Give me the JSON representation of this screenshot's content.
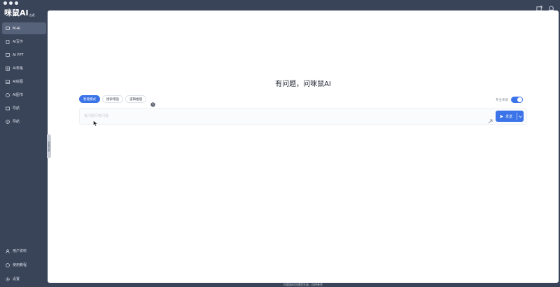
{
  "app": {
    "logo_main": "咪鼠AI",
    "logo_sub": "志遊"
  },
  "sidebar": {
    "items": [
      {
        "label": "M-AI",
        "icon": "chat-icon",
        "active": true
      },
      {
        "label": "AI写作",
        "icon": "document-icon"
      },
      {
        "label": "AI PPT",
        "icon": "presentation-icon"
      },
      {
        "label": "AI表格",
        "icon": "table-icon"
      },
      {
        "label": "AI绘图",
        "icon": "image-icon"
      },
      {
        "label": "AI图书",
        "icon": "book-icon"
      },
      {
        "label": "导航",
        "icon": "compass-icon"
      },
      {
        "label": "导航",
        "icon": "navigation-icon"
      }
    ],
    "bottom_items": [
      {
        "label": "用户资料",
        "icon": "user-icon"
      },
      {
        "label": "使用教程",
        "icon": "help-circle-icon"
      },
      {
        "label": "设置",
        "icon": "gear-icon"
      }
    ]
  },
  "collapse_tab_label": "收起侧边栏",
  "main": {
    "headline": "有问题，问咪鼠AI",
    "modes": [
      {
        "label": "智能模式",
        "active": true
      },
      {
        "label": "搜索增强"
      },
      {
        "label": "逻辑推理"
      }
    ],
    "toggle_label": "专业术语",
    "input_placeholder": "有问题尽管问我",
    "send_label": "发送"
  },
  "footer": "内容由AI大模型生成，仅供参考",
  "colors": {
    "accent": "#3b73e8",
    "sidebar_bg": "#3a4458",
    "panel_bg": "#ffffff"
  }
}
